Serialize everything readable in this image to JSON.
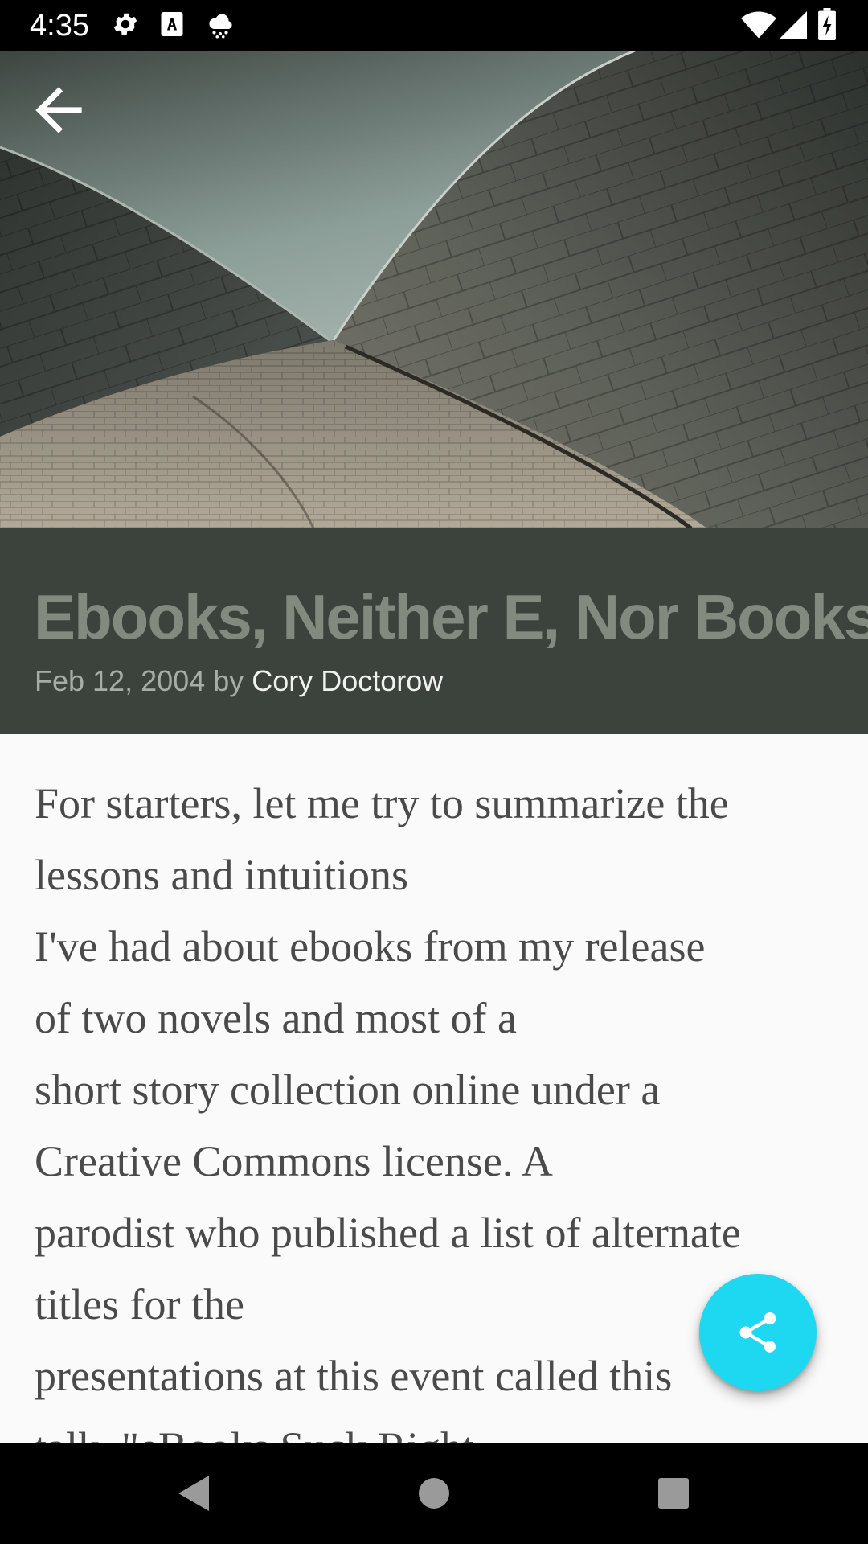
{
  "status_bar": {
    "time": "4:35",
    "left_icons": [
      "settings-icon",
      "text-a-icon",
      "weather-icon"
    ],
    "right_icons": [
      "wifi-icon",
      "signal-icon",
      "battery-charging-icon"
    ]
  },
  "hero": {
    "image": "opera-house-roof-photo",
    "back_icon": "arrow-back-icon"
  },
  "article": {
    "title": "Ebooks, Neither E, Nor Books",
    "date": "Feb 12, 2004",
    "by": "by",
    "author": "Cory Doctorow",
    "body_lines": [
      "For starters, let me try to summarize the",
      "lessons and intuitions",
      "I've had about ebooks from my release",
      "of two novels and most of a",
      "short story collection online under a",
      "Creative Commons license. A",
      "parodist who published a list of alternate",
      "titles for the",
      "presentations at this event called this",
      "talk, \"eBooks Suck Right"
    ]
  },
  "fab": {
    "icon": "share-icon",
    "color": "#1ed7f0"
  },
  "nav_bar": {
    "icons": [
      "back-triangle-icon",
      "home-circle-icon",
      "recents-square-icon"
    ]
  },
  "colors": {
    "title_band": "#3c433d",
    "title_text": "#828a80",
    "body_text": "#4a4a4a"
  }
}
